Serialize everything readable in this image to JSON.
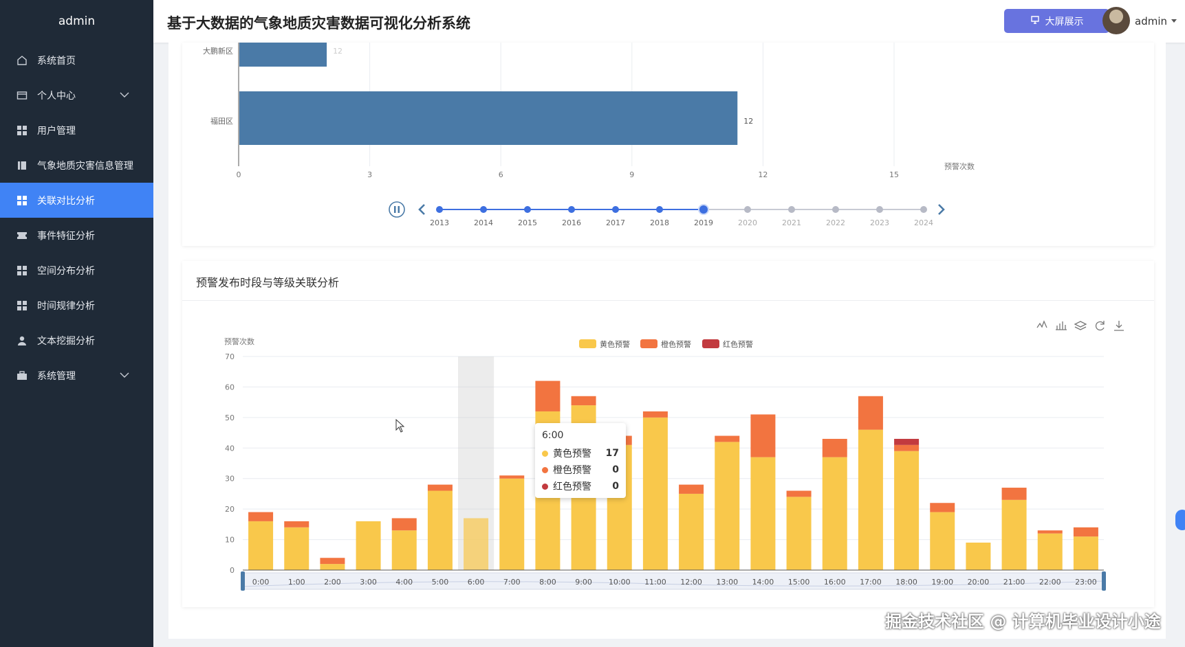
{
  "sidebar": {
    "title": "admin",
    "items": [
      {
        "label": "系统首页",
        "icon": "home-icon"
      },
      {
        "label": "个人中心",
        "icon": "id-card-icon"
      },
      {
        "label": "用户管理",
        "icon": "grid-icon"
      },
      {
        "label": "气象地质灾害信息管理",
        "icon": "book-icon"
      },
      {
        "label": "关联对比分析",
        "icon": "grid-icon"
      },
      {
        "label": "事件特征分析",
        "icon": "ticket-icon"
      },
      {
        "label": "空间分布分析",
        "icon": "grid-icon"
      },
      {
        "label": "时间规律分析",
        "icon": "grid-icon"
      },
      {
        "label": "文本挖掘分析",
        "icon": "user-icon"
      },
      {
        "label": "系统管理",
        "icon": "briefcase-icon"
      }
    ]
  },
  "header": {
    "title": "基于大数据的气象地质灾害数据可视化分析系统",
    "bigscreen_label": "大屏展示",
    "user_name": "admin"
  },
  "colors": {
    "sidebar_bg": "#1f2a37",
    "active": "#4083f5",
    "button": "#6873df",
    "yellow": "#f9c84b",
    "orange": "#f27440",
    "red": "#c23a3f",
    "bar_blue": "#4a7aa7"
  },
  "chart_data": [
    {
      "type": "bar",
      "orientation": "horizontal",
      "categories": [
        "大鹏新区",
        "福田区"
      ],
      "values": [
        2,
        11.4
      ],
      "data_labels": [
        "12",
        "12"
      ],
      "xlabel": "预警次数",
      "xticks": [
        "0",
        "3",
        "6",
        "9",
        "12",
        "15"
      ],
      "xlim": [
        0,
        15
      ],
      "timeline": {
        "years": [
          "2013",
          "2014",
          "2015",
          "2016",
          "2017",
          "2018",
          "2019",
          "2020",
          "2021",
          "2022",
          "2023",
          "2024"
        ],
        "current": "2019"
      }
    },
    {
      "type": "bar",
      "stacked": true,
      "title": "预警发布时段与等级关联分析",
      "ylabel": "预警次数",
      "ylim": [
        0,
        70
      ],
      "yticks": [
        "0",
        "10",
        "20",
        "30",
        "40",
        "50",
        "60",
        "70"
      ],
      "categories": [
        "0:00",
        "1:00",
        "2:00",
        "3:00",
        "4:00",
        "5:00",
        "6:00",
        "7:00",
        "8:00",
        "9:00",
        "10:00",
        "11:00",
        "12:00",
        "13:00",
        "14:00",
        "15:00",
        "16:00",
        "17:00",
        "18:00",
        "19:00",
        "20:00",
        "21:00",
        "22:00",
        "23:00"
      ],
      "series": [
        {
          "name": "黄色预警",
          "values": [
            16,
            14,
            2,
            16,
            13,
            26,
            17,
            30,
            52,
            54,
            41,
            50,
            25,
            42,
            37,
            24,
            37,
            46,
            39,
            19,
            9,
            23,
            12,
            11
          ]
        },
        {
          "name": "橙色预警",
          "values": [
            3,
            2,
            2,
            0,
            4,
            2,
            0,
            1,
            10,
            3,
            3,
            2,
            3,
            2,
            14,
            2,
            6,
            11,
            2,
            3,
            0,
            4,
            1,
            3
          ]
        },
        {
          "name": "红色预警",
          "values": [
            0,
            0,
            0,
            0,
            0,
            0,
            0,
            0,
            0,
            0,
            0,
            0,
            0,
            0,
            0,
            0,
            0,
            0,
            2,
            0,
            0,
            0,
            0,
            0
          ]
        }
      ],
      "legend": "top-center",
      "tooltip": {
        "title": "6:00",
        "rows": [
          {
            "label": "黄色预警",
            "value": "17"
          },
          {
            "label": "橙色预警",
            "value": "0"
          },
          {
            "label": "红色预警",
            "value": "0"
          }
        ]
      }
    }
  ],
  "watermark": "掘金技术社区 @ 计算机毕业设计小途"
}
